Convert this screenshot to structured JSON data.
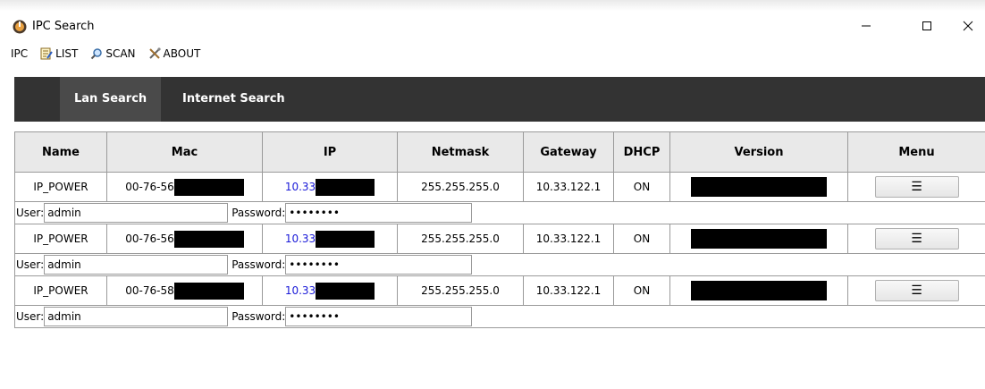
{
  "window": {
    "title": "IPC Search",
    "minimize_glyph": "—",
    "maximize_glyph": "☐",
    "close_glyph": "✕"
  },
  "menubar": {
    "items": [
      {
        "label": "IPC",
        "icon": "none"
      },
      {
        "label": "LIST",
        "icon": "list-icon"
      },
      {
        "label": "SCAN",
        "icon": "search-icon"
      },
      {
        "label": "ABOUT",
        "icon": "tools-icon"
      }
    ]
  },
  "nav": {
    "tabs": [
      {
        "label": "Lan Search",
        "active": true
      },
      {
        "label": "Internet Search",
        "active": false
      }
    ]
  },
  "table": {
    "headers": [
      "Name",
      "Mac",
      "IP",
      "Netmask",
      "Gateway",
      "DHCP",
      "Version",
      "Menu"
    ],
    "rows": [
      {
        "name": "IP_POWER",
        "mac": "00-76-56",
        "ip": "10.33",
        "netmask": "255.255.255.0",
        "gateway": "10.33.122.1",
        "dhcp": "ON",
        "user_label": "User:",
        "user": "admin",
        "password_label": "Password:",
        "password": "••••••••",
        "menu_glyph": "☰"
      },
      {
        "name": "IP_POWER",
        "mac": "00-76-56",
        "ip": "10.33",
        "netmask": "255.255.255.0",
        "gateway": "10.33.122.1",
        "dhcp": "ON",
        "user_label": "User:",
        "user": "admin",
        "password_label": "Password:",
        "password": "••••••••",
        "menu_glyph": "☰"
      },
      {
        "name": "IP_POWER",
        "mac": "00-76-58",
        "ip": "10.33",
        "netmask": "255.255.255.0",
        "gateway": "10.33.122.1",
        "dhcp": "ON",
        "user_label": "User:",
        "user": "admin",
        "password_label": "Password:",
        "password": "••••••••",
        "menu_glyph": "☰"
      }
    ]
  },
  "colors": {
    "nav_bg": "#333333",
    "nav_active": "#4a4a4a",
    "ip_link": "#1a1ad8",
    "header_bg": "#e9e9e9"
  }
}
